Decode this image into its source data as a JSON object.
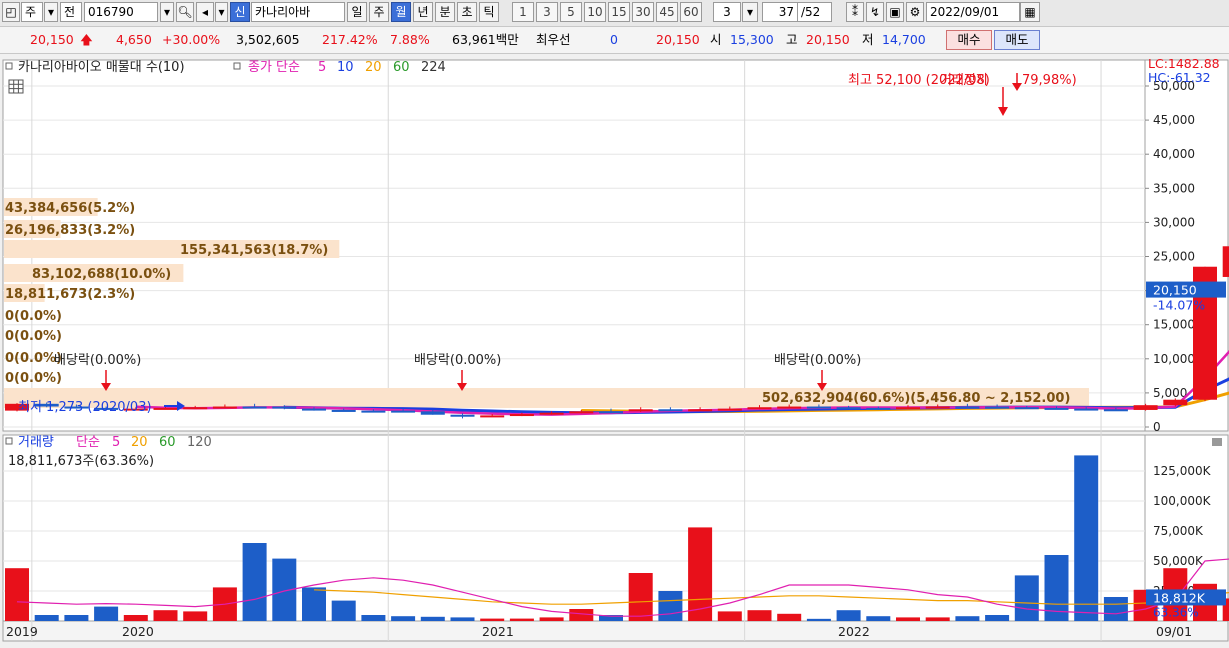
{
  "toolbar": {
    "period_left": "주",
    "market_label": "전",
    "stock_code": "016790",
    "new_tag": "신",
    "stock_name": "카나리아바",
    "periods": [
      "일",
      "주",
      "월",
      "년",
      "분",
      "초",
      "틱"
    ],
    "active_period": "월",
    "intervals": [
      "1",
      "3",
      "5",
      "10",
      "15",
      "30",
      "45",
      "60"
    ],
    "interval_value": "3",
    "page_counter": "37",
    "page_total": "/52",
    "date": "2022/09/01"
  },
  "quote": {
    "price": "20,150",
    "change": "4,650",
    "change_pct": "+30.00%",
    "volume": "3,502,605",
    "volume_ratio": "217.42%",
    "turnover": "7.88%",
    "trade_value": "63,961백만",
    "priority_label": "최우선",
    "priority_value": "0",
    "price2": "20,150",
    "open_label": "시",
    "open": "15,300",
    "high_label": "고",
    "high": "20,150",
    "low_label": "저",
    "low": "14,700",
    "buy_label": "매수",
    "sell_label": "매도"
  },
  "price_panel": {
    "title": "카나리아바이오 매물대 수(10)",
    "ma_label": "종가 단순",
    "ma_periods": [
      "5",
      "10",
      "20",
      "60",
      "224"
    ],
    "high_note": "최고 52,100 (2022/08)",
    "overlap_note": "거래정지",
    "pct_note": "79,98%)",
    "low_note": "최저 1,273 (2020/03)",
    "lc_label": "LC:1482.88",
    "hc_label": "HC:-61.32",
    "price_tag": "20,150",
    "price_tag_pct": "-14.07%",
    "dividend_label": "배당락(0.00%)",
    "yaxis_labels": [
      "50,000",
      "45,000",
      "40,000",
      "35,000",
      "30,000",
      "25,000",
      "20,000",
      "15,000",
      "10,000",
      "5,000",
      "0"
    ]
  },
  "volume_profile": [
    {
      "label": "43,384,656(5.2%)",
      "value": 43384656
    },
    {
      "label": "26,196,833(3.2%)",
      "value": 26196833
    },
    {
      "label": "155,341,563(18.7%)",
      "value": 155341563
    },
    {
      "label": "83,102,688(10.0%)",
      "value": 83102688
    },
    {
      "label": "18,811,673(2.3%)",
      "value": 18811673
    },
    {
      "label": "0(0.0%)",
      "value": 0
    },
    {
      "label": "0(0.0%)",
      "value": 0
    },
    {
      "label": "0(0.0%)",
      "value": 0
    },
    {
      "label": "0(0.0%)",
      "value": 0
    },
    {
      "label": "502,632,904(60.6%)(5,456.80 ~ 2,152.00)",
      "value": 502632904
    }
  ],
  "volume_panel": {
    "title": "거래량",
    "ma_label": "단순",
    "ma_periods": [
      "5",
      "20",
      "60",
      "120"
    ],
    "current_label": "18,811,673주(63.36%)",
    "volume_tag": "18,812K",
    "volume_tag_pct": "63.36%",
    "yaxis_labels": [
      "125,000K",
      "100,000K",
      "75,000K",
      "50,000K",
      "25,000K"
    ]
  },
  "xaxis": {
    "labels": [
      "2019",
      "2020",
      "2021",
      "2022",
      "09/01"
    ]
  },
  "colors": {
    "up": "#e8101a",
    "down": "#1d5ec8",
    "ma5": "#e020b0",
    "ma10": "#1a3fe0",
    "ma20": "#f0a000",
    "ma60": "#2a9a2a",
    "ma224": "#333333",
    "profile": "#fbe3cc",
    "profile_text": "#7a5010"
  },
  "chart_data": [
    {
      "type": "candlestick",
      "title": "카나리아바이오",
      "x": [
        "2018-12",
        "2019-01",
        "2019-02",
        "2019-03",
        "2019-04",
        "2019-05",
        "2019-06",
        "2019-07",
        "2019-08",
        "2019-09",
        "2019-10",
        "2019-11",
        "2019-12",
        "2020-01",
        "2020-02",
        "2020-03",
        "2020-04",
        "2020-05",
        "2020-06",
        "2020-07",
        "2020-08",
        "2020-09",
        "2020-10",
        "2020-11",
        "2020-12",
        "2021-01",
        "2021-02",
        "2021-03",
        "2021-04",
        "2021-05",
        "2021-06",
        "2021-07",
        "2021-08",
        "2021-09",
        "2021-10",
        "2021-11",
        "2021-12",
        "2022-01",
        "2022-02",
        "2022-03",
        "2022-04",
        "2022-05",
        "2022-06",
        "2022-07",
        "2022-08",
        "2022-09"
      ],
      "open": [
        2400,
        3400,
        3000,
        2800,
        2600,
        2700,
        2800,
        2900,
        3000,
        3000,
        2700,
        2500,
        2400,
        2400,
        2300,
        1800,
        1600,
        1700,
        1900,
        2100,
        2300,
        2300,
        2600,
        2500,
        2600,
        2700,
        2900,
        3000,
        2900,
        2800,
        2700,
        2900,
        3000,
        3000,
        2900,
        2800,
        2700,
        2600,
        2500,
        3200,
        4000,
        22000,
        26000,
        28000,
        33000,
        15300
      ],
      "high": [
        3500,
        3600,
        3300,
        3000,
        2900,
        3000,
        3100,
        3300,
        3400,
        3200,
        2900,
        2700,
        2600,
        2700,
        2500,
        2000,
        1900,
        2100,
        2300,
        2500,
        2700,
        2900,
        2900,
        2900,
        3000,
        3200,
        3300,
        3300,
        3100,
        3000,
        3200,
        3300,
        3400,
        3300,
        3100,
        3000,
        2900,
        2800,
        3400,
        4200,
        23500,
        35000,
        28500,
        48000,
        52100,
        20150
      ],
      "low": [
        2300,
        2900,
        2700,
        2500,
        2500,
        2600,
        2700,
        2800,
        2900,
        2600,
        2400,
        2300,
        2300,
        2200,
        1800,
        1273,
        1500,
        1600,
        1800,
        2000,
        2200,
        2200,
        2400,
        2400,
        2500,
        2600,
        2800,
        2800,
        2700,
        2600,
        2600,
        2800,
        2900,
        2800,
        2700,
        2600,
        2500,
        2400,
        2400,
        3000,
        3800,
        16000,
        22000,
        27000,
        33000,
        14700
      ],
      "close": [
        3400,
        3000,
        2800,
        2600,
        2700,
        2800,
        2900,
        3000,
        3000,
        2700,
        2500,
        2400,
        2400,
        2300,
        1800,
        1600,
        1700,
        1900,
        2100,
        2300,
        2300,
        2600,
        2500,
        2600,
        2700,
        2900,
        3000,
        2900,
        2800,
        2700,
        2900,
        3000,
        3000,
        2900,
        2800,
        2700,
        2600,
        2500,
        3200,
        4000,
        23500,
        26500,
        27500,
        29000,
        23500,
        20150
      ],
      "ma5": [
        null,
        null,
        null,
        null,
        2960,
        2820,
        2760,
        2800,
        2880,
        2880,
        2820,
        2720,
        2600,
        2460,
        2280,
        2100,
        1960,
        1860,
        1820,
        1920,
        2060,
        2240,
        2360,
        2460,
        2540,
        2660,
        2740,
        2820,
        2860,
        2860,
        2860,
        2860,
        2880,
        2900,
        2920,
        2880,
        2800,
        2700,
        2760,
        3000,
        7160,
        11940,
        16940,
        22100,
        26000,
        26120
      ],
      "ma10": [
        null,
        null,
        null,
        null,
        null,
        null,
        null,
        null,
        null,
        2890,
        2810,
        2750,
        2730,
        2700,
        2620,
        2460,
        2340,
        2230,
        2140,
        2100,
        2090,
        2140,
        2200,
        2270,
        2360,
        2490,
        2560,
        2620,
        2700,
        2720,
        2790,
        2830,
        2880,
        2910,
        2920,
        2920,
        2880,
        2830,
        2850,
        2900,
        5380,
        7420,
        9830,
        12560,
        14280,
        15690
      ],
      "ma20": [
        null,
        null,
        null,
        null,
        null,
        null,
        null,
        null,
        null,
        null,
        null,
        null,
        null,
        null,
        null,
        null,
        null,
        null,
        null,
        2420,
        2360,
        2300,
        2260,
        2260,
        2270,
        2300,
        2360,
        2440,
        2480,
        2540,
        2600,
        2650,
        2720,
        2770,
        2820,
        2860,
        2880,
        2890,
        2910,
        2940,
        4000,
        5200,
        6400,
        7700,
        8800,
        9900
      ],
      "bullish": [
        true,
        false,
        false,
        false,
        true,
        true,
        true,
        true,
        false,
        false,
        false,
        false,
        false,
        false,
        false,
        false,
        true,
        true,
        true,
        true,
        false,
        true,
        false,
        true,
        true,
        true,
        true,
        false,
        false,
        false,
        true,
        true,
        false,
        false,
        false,
        false,
        false,
        false,
        true,
        true,
        true,
        true,
        true,
        true,
        false,
        true
      ],
      "xlabel": "",
      "ylabel": "",
      "ylim": [
        0,
        50000
      ]
    },
    {
      "type": "bar",
      "title": "거래량",
      "x": [
        "2018-12",
        "2019-01",
        "2019-02",
        "2019-03",
        "2019-04",
        "2019-05",
        "2019-06",
        "2019-07",
        "2019-08",
        "2019-09",
        "2019-10",
        "2019-11",
        "2019-12",
        "2020-01",
        "2020-02",
        "2020-03",
        "2020-04",
        "2020-05",
        "2020-06",
        "2020-07",
        "2020-08",
        "2020-09",
        "2020-10",
        "2020-11",
        "2020-12",
        "2021-01",
        "2021-02",
        "2021-03",
        "2021-04",
        "2021-05",
        "2021-06",
        "2021-07",
        "2021-08",
        "2021-09",
        "2021-10",
        "2021-11",
        "2021-12",
        "2022-01",
        "2022-02",
        "2022-03",
        "2022-04",
        "2022-05",
        "2022-06",
        "2022-07",
        "2022-08",
        "2022-09"
      ],
      "values": [
        44000,
        5000,
        5000,
        12000,
        5000,
        9000,
        8000,
        28000,
        65000,
        52000,
        28000,
        17000,
        5000,
        4000,
        3500,
        3000,
        2000,
        2000,
        3000,
        10000,
        5000,
        40000,
        25000,
        78000,
        8000,
        9000,
        6000,
        1800,
        9000,
        4000,
        3000,
        3000,
        4000,
        5000,
        38000,
        55000,
        138000,
        20000,
        26000,
        44000,
        31000,
        18800,
        null,
        null,
        null,
        null
      ],
      "ma5": [
        16000,
        15000,
        14000,
        14500,
        14000,
        13000,
        12000,
        14000,
        18000,
        25000,
        30000,
        34000,
        36000,
        34000,
        30000,
        24000,
        18000,
        12000,
        8000,
        6000,
        4000,
        4000,
        6000,
        10000,
        15000,
        22000,
        30000,
        30000,
        30000,
        28000,
        26000,
        22000,
        20000,
        14000,
        10000,
        8000,
        7000,
        6000,
        10000,
        18000,
        50000,
        52000,
        55000,
        50000,
        25000,
        null
      ],
      "ma20": [
        null,
        null,
        null,
        null,
        null,
        null,
        null,
        null,
        null,
        null,
        26000,
        25000,
        24000,
        22000,
        20000,
        18000,
        16000,
        15000,
        14000,
        14000,
        15000,
        16000,
        17000,
        18000,
        19000,
        20000,
        21000,
        21000,
        20000,
        19000,
        18000,
        17000,
        17000,
        16000,
        15000,
        14000,
        14000,
        14000,
        15000,
        17000,
        22000,
        24000,
        25000,
        26000,
        26000,
        null
      ],
      "xlabel": "",
      "ylabel": "",
      "ylim": [
        0,
        145000
      ]
    }
  ]
}
